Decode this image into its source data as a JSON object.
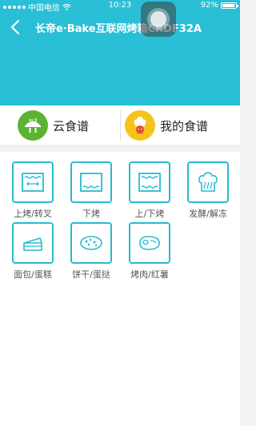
{
  "status_bar": {
    "carrier": "中国电信",
    "time": "10:23",
    "battery": "92%",
    "battery_level": 0.92
  },
  "header": {
    "title": "长帝e·Bake互联网烤箱CRDF32A",
    "back_icon": "chevron-left-icon",
    "color": "#29bfd6"
  },
  "recipes": [
    {
      "label": "云食谱",
      "icon": "fork-knife-icon",
      "color": "#5bb333"
    },
    {
      "label": "我的食谱",
      "icon": "chef-hat-icon",
      "color": "#f5c31b"
    }
  ],
  "modes": [
    {
      "label": "上烤/转叉",
      "icon": "top-heat-rotisserie-icon"
    },
    {
      "label": "下烤",
      "icon": "bottom-heat-icon"
    },
    {
      "label": "上/下烤",
      "icon": "top-bottom-heat-icon"
    },
    {
      "label": "发酵/解冻",
      "icon": "ferment-defrost-icon"
    },
    {
      "label": "面包/蛋糕",
      "icon": "cake-icon"
    },
    {
      "label": "饼干/蛋挞",
      "icon": "cookie-icon"
    },
    {
      "label": "烤肉/红薯",
      "icon": "meat-icon"
    }
  ],
  "accent_color": "#26bccf"
}
